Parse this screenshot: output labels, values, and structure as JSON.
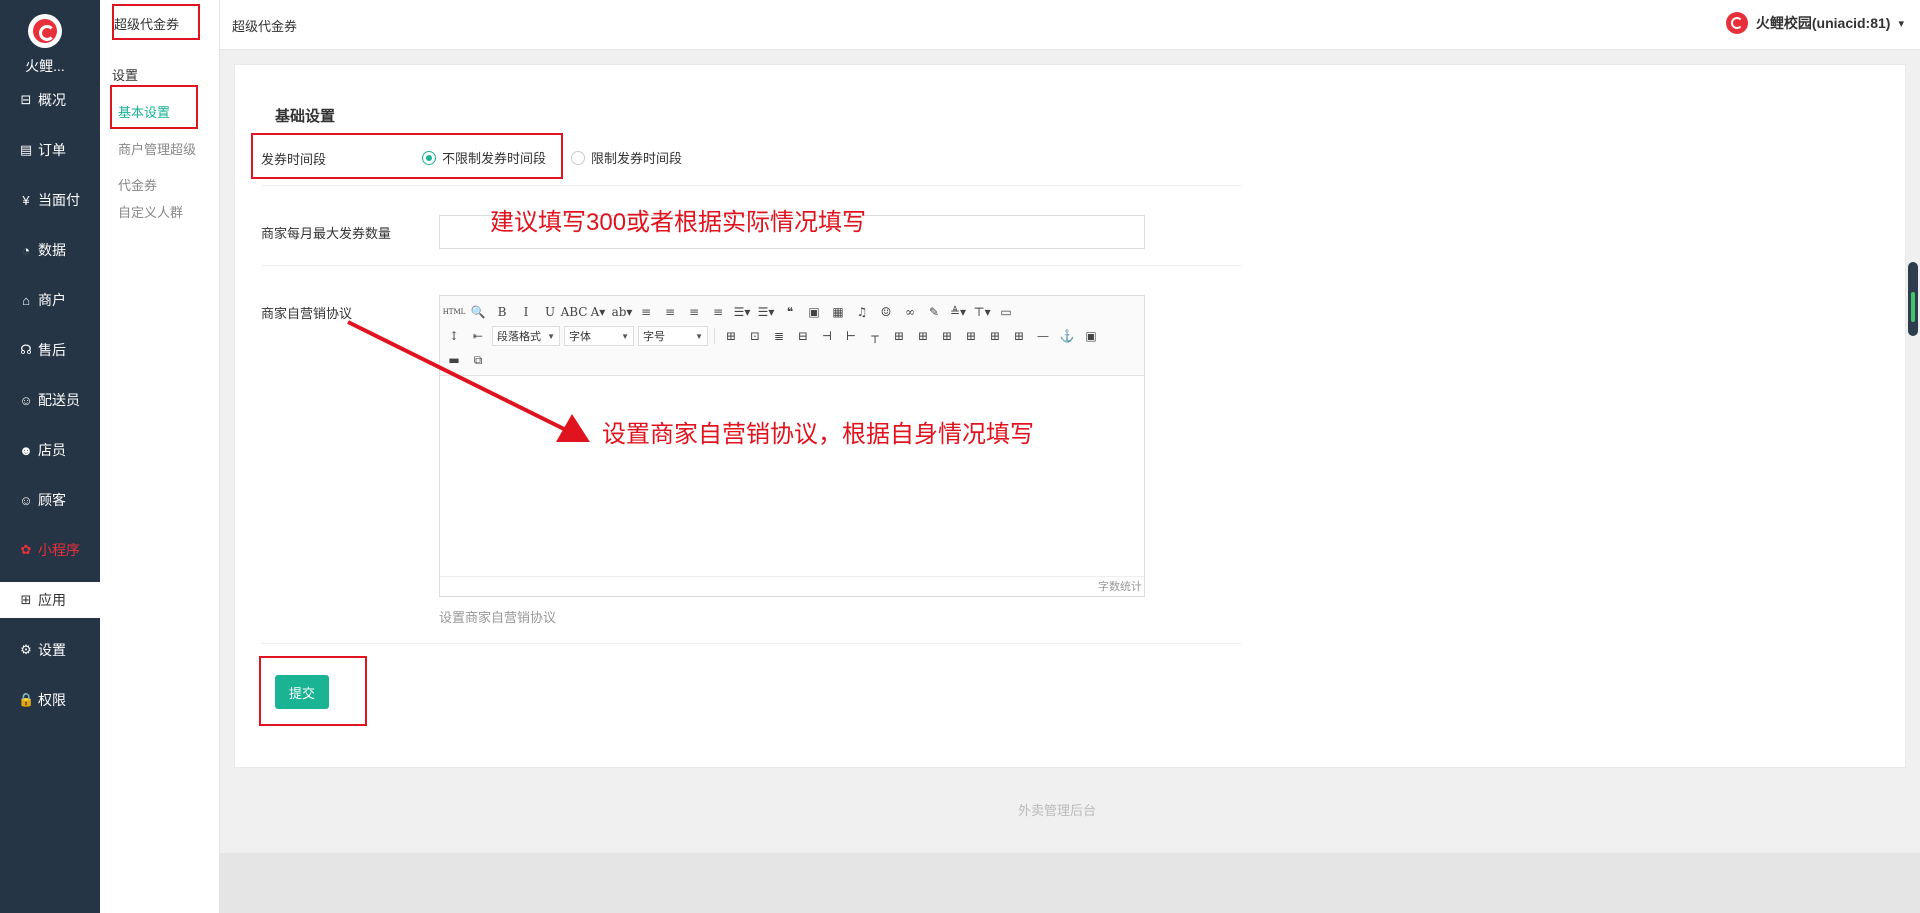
{
  "sidebar": {
    "app_name": "火鲤...",
    "items": [
      {
        "label": "概况",
        "icon": "overview-icon",
        "glyph": "⊟"
      },
      {
        "label": "订单",
        "icon": "order-icon",
        "glyph": "▤"
      },
      {
        "label": "当面付",
        "icon": "yen-icon",
        "glyph": "¥"
      },
      {
        "label": "数据",
        "icon": "chart-icon",
        "glyph": "◔"
      },
      {
        "label": "商户",
        "icon": "store-icon",
        "glyph": "⌂"
      },
      {
        "label": "售后",
        "icon": "service-icon",
        "glyph": "☊"
      },
      {
        "label": "配送员",
        "icon": "courier-icon",
        "glyph": "☺"
      },
      {
        "label": "店员",
        "icon": "clerk-icon",
        "glyph": "☻"
      },
      {
        "label": "顾客",
        "icon": "customer-icon",
        "glyph": "☺"
      },
      {
        "label": "小程序",
        "icon": "miniapp-icon",
        "glyph": "✿"
      },
      {
        "label": "应用",
        "icon": "apps-icon",
        "glyph": "⊞"
      },
      {
        "label": "设置",
        "icon": "gear-icon",
        "glyph": "⚙"
      },
      {
        "label": "权限",
        "icon": "lock-icon",
        "glyph": "🔒"
      }
    ]
  },
  "subnav": {
    "title": "超级代金券",
    "group": "设置",
    "items": [
      "基本设置",
      "商户管理超级",
      "代金券",
      "自定义人群"
    ]
  },
  "header": {
    "breadcrumb": "超级代金券",
    "user": "火鲤校园(uniacid:81)",
    "caret": "▾"
  },
  "form": {
    "section_title": "基础设置",
    "period_label": "发券时间段",
    "period_options": [
      "不限制发券时间段",
      "限制发券时间段"
    ],
    "period_selected": 0,
    "max_label": "商家每月最大发券数量",
    "max_value": "",
    "agreement_label": "商家自营销协议",
    "help_text": "设置商家自营销协议",
    "submit_label": "提交"
  },
  "editor": {
    "word_count": "字数统计",
    "toolbar_row1": [
      "HTML",
      "🔍",
      "B",
      "I",
      "U",
      "ABC",
      "A▾",
      "ab▾",
      "≡",
      "≡",
      "≡",
      "≡",
      "☰▾",
      "☰▾",
      "❝",
      "▣",
      "▦",
      "♫",
      "☺",
      "∞",
      "✎",
      "≜▾",
      "⊤▾",
      "▭"
    ],
    "toolbar_row2": [
      "↕▾",
      "⇤",
      "⊞",
      "⊡",
      "≣",
      "⊟",
      "⊣",
      "⊢",
      "┬",
      "⊞",
      "⊞",
      "⊞",
      "⊞",
      "⊞",
      "⊞",
      "—",
      "⚓",
      "▣"
    ],
    "toolbar_row3": [
      "▬",
      "⧉"
    ],
    "selects": {
      "paragraph": "段落格式",
      "font": "字体",
      "size": "字号"
    }
  },
  "annotations": {
    "max_hint": "建议填写300或者根据实际情况填写",
    "agreement_hint": "设置商家自营销协议，根据自身情况填写"
  },
  "footer": {
    "text": "外卖管理后台"
  },
  "colors": {
    "sidebar_bg": "#263545",
    "accent": "#1ab394",
    "annotation_red": "#e0141e"
  }
}
